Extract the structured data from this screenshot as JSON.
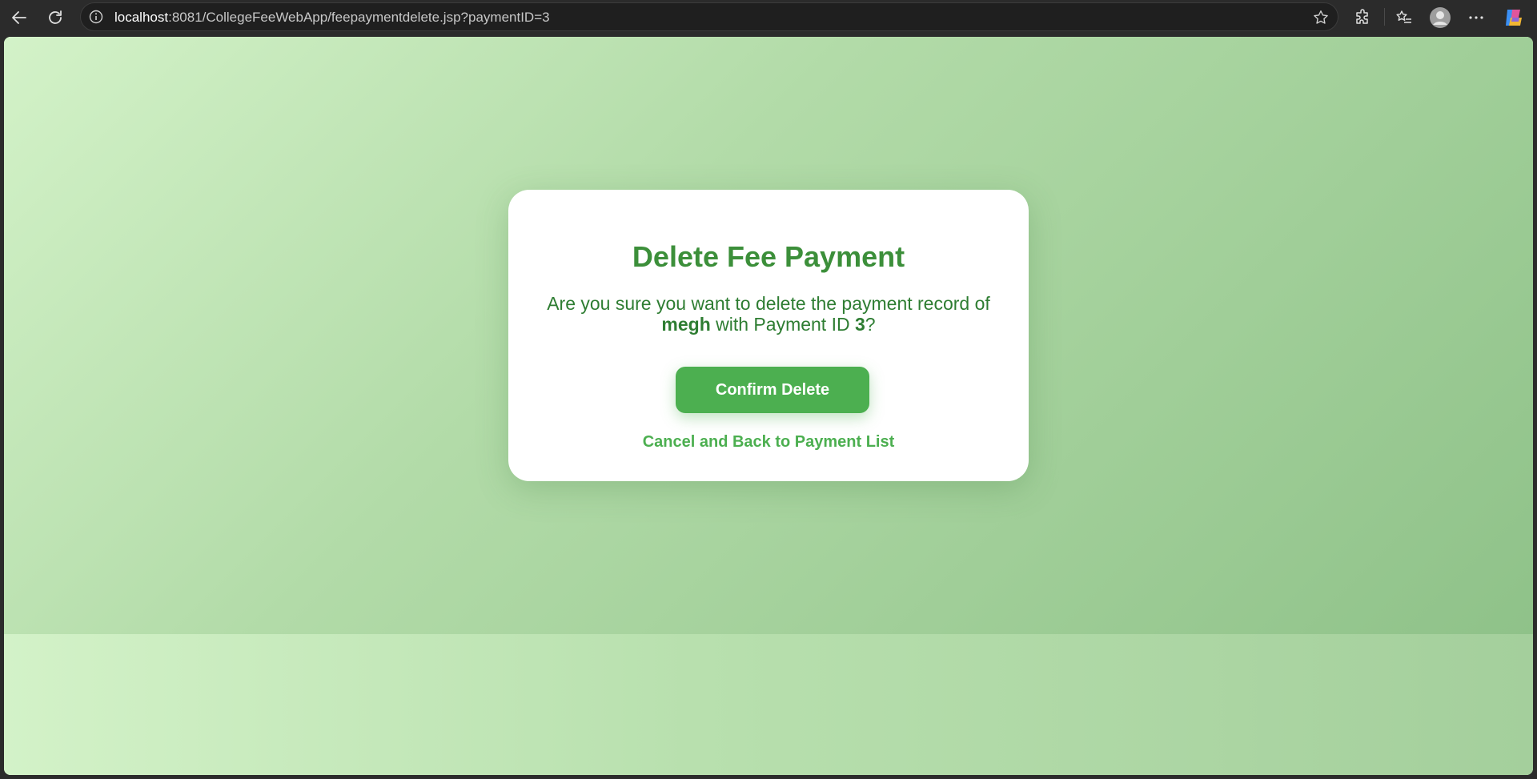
{
  "browser": {
    "url_host": "localhost",
    "url_rest": ":8081/CollegeFeeWebApp/feepaymentdelete.jsp?paymentID=3"
  },
  "dialog": {
    "title": "Delete Fee Payment",
    "message_prefix": "Are you sure you want to delete the payment record of ",
    "student_name": "megh",
    "message_middle": " with Payment ID ",
    "payment_id": "3",
    "message_suffix": "?",
    "confirm_label": "Confirm Delete",
    "cancel_label": "Cancel and Back to Payment List"
  },
  "colors": {
    "title_green": "#3c8f3a",
    "message_green": "#2e7d32",
    "button_green": "#4caf50",
    "background_light": "#d3f2c8",
    "background_dark": "#8fc289"
  }
}
